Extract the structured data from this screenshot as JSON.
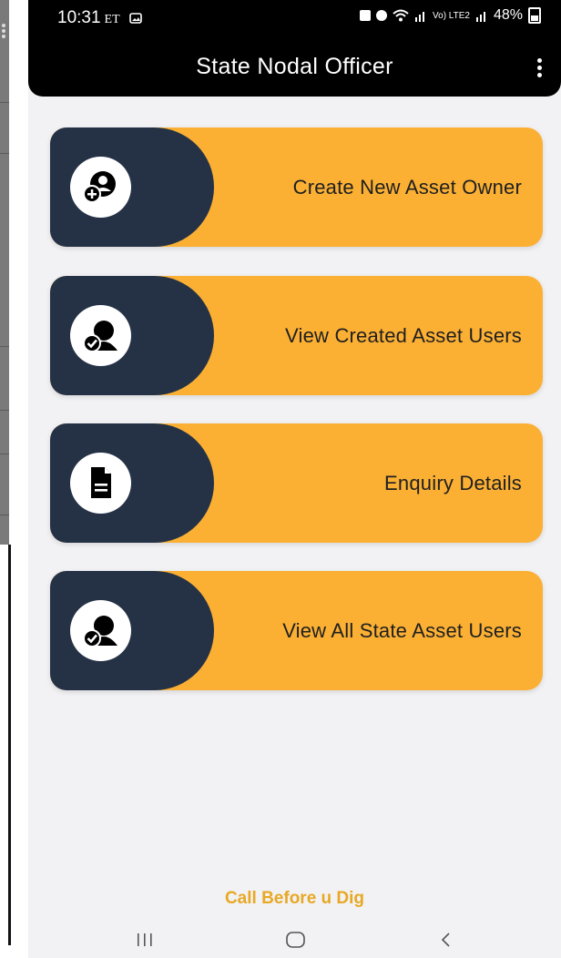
{
  "status_bar": {
    "time": "10:31",
    "carrier_tag": "ET",
    "battery": "48%",
    "network": "Vo) LTE2"
  },
  "app_bar": {
    "title": "State Nodal Officer"
  },
  "menu": [
    {
      "label": "Create New Asset Owner",
      "icon": "add-user-icon"
    },
    {
      "label": "View Created Asset Users",
      "icon": "verified-user-icon"
    },
    {
      "label": "Enquiry Details",
      "icon": "document-icon"
    },
    {
      "label": "View All State Asset Users",
      "icon": "verified-user-icon"
    }
  ],
  "footer": {
    "link": "Call Before u Dig"
  },
  "colors": {
    "card": "#fbb034",
    "card_accent": "#253246",
    "app_bar": "#000000",
    "footer_link": "#e8a825"
  }
}
